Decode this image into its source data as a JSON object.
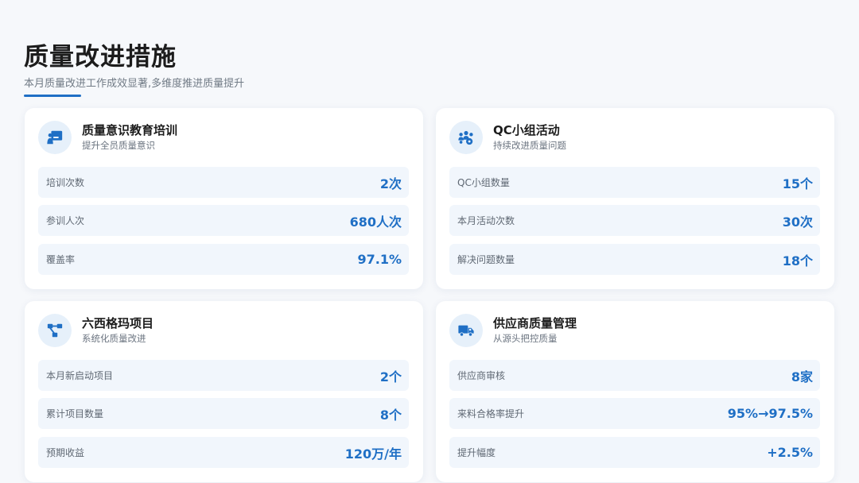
{
  "header": {
    "title": "质量改进措施",
    "subtitle": "本月质量改进工作成效显著,多维度推进质量提升"
  },
  "colors": {
    "accent": "#1f6fc5",
    "icon_bg": "#e6f0fa",
    "row_bg": "#f1f6fc"
  },
  "cards": [
    {
      "title": "质量意识教育培训",
      "subtitle": "提升全员质量意识",
      "icon": "presentation-board-icon",
      "metrics": [
        {
          "label": "培训次数",
          "value": "2次"
        },
        {
          "label": "参训人次",
          "value": "680人次"
        },
        {
          "label": "覆盖率",
          "value": "97.1%"
        }
      ]
    },
    {
      "title": "QC小组活动",
      "subtitle": "持续改进质量问题",
      "icon": "users-gear-icon",
      "metrics": [
        {
          "label": "QC小组数量",
          "value": "15个"
        },
        {
          "label": "本月活动次数",
          "value": "30次"
        },
        {
          "label": "解决问题数量",
          "value": "18个"
        }
      ]
    },
    {
      "title": "六西格玛项目",
      "subtitle": "系统化质量改进",
      "icon": "project-diagram-icon",
      "metrics": [
        {
          "label": "本月新启动项目",
          "value": "2个"
        },
        {
          "label": "累计项目数量",
          "value": "8个"
        },
        {
          "label": "预期收益",
          "value": "120万/年"
        }
      ]
    },
    {
      "title": "供应商质量管理",
      "subtitle": "从源头把控质量",
      "icon": "truck-icon",
      "metrics": [
        {
          "label": "供应商审核",
          "value": "8家"
        },
        {
          "label": "来料合格率提升",
          "value": "95%→97.5%"
        },
        {
          "label": "提升幅度",
          "value": "+2.5%"
        }
      ]
    }
  ]
}
